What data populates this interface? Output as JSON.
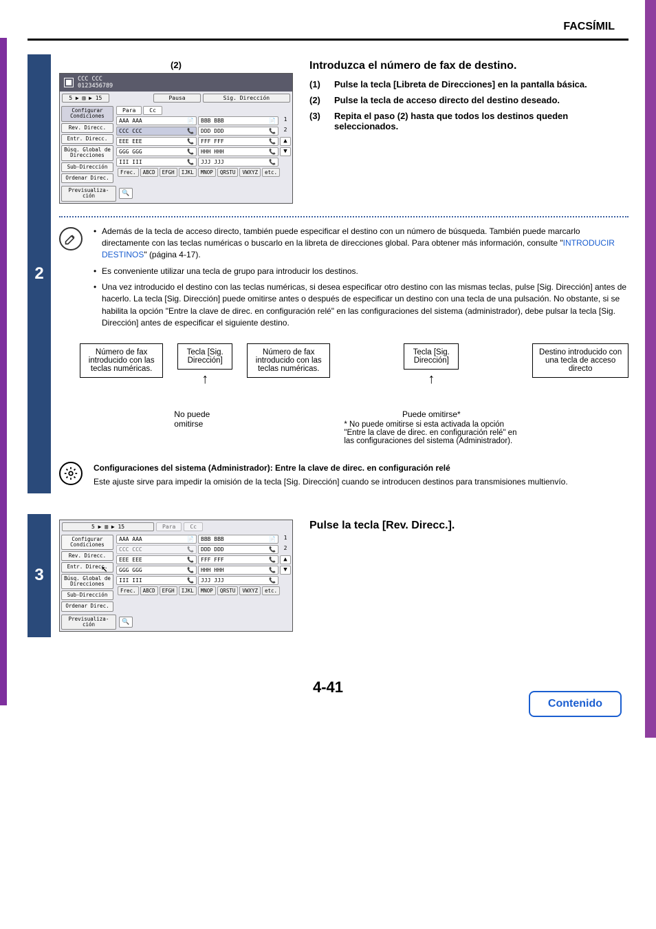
{
  "header": {
    "title": "FACSÍMIL"
  },
  "page_number": "4-41",
  "contenido": "Contenido",
  "step2": {
    "num": "2",
    "label_above": "(2)",
    "heading": "Introduzca el número de fax de destino.",
    "substeps": [
      {
        "n": "(1)",
        "t": "Pulse la tecla [Libreta de Direcciones] en la pantalla básica."
      },
      {
        "n": "(2)",
        "t": "Pulse la tecla de acceso directo del destino deseado."
      },
      {
        "n": "(3)",
        "t": "Repita el paso (2) hasta que todos los destinos queden seleccionados."
      }
    ],
    "screenshot": {
      "dest_name": "CCC CCC",
      "dest_num": "0123456789",
      "btn_pausa": "Pausa",
      "btn_sig": "Sig. Dirección",
      "crumbs": "5 ▶ ▥ ▶ 15",
      "tab_para": "Para",
      "tab_cc": "Cc",
      "side": [
        "Configurar Condiciones",
        "Rev. Direcc.",
        "Entr. Direcc.",
        "Búsq. Global de Direcciones",
        "Sub-Dirección",
        "Ordenar Direc.",
        "Previsualiza-ción"
      ],
      "addr": [
        [
          "AAA AAA",
          "BBB BBB"
        ],
        [
          "CCC CCC",
          "DDD DDD"
        ],
        [
          "EEE EEE",
          "FFF FFF"
        ],
        [
          "GGG GGG",
          "HHH HHH"
        ],
        [
          "III III",
          "JJJ JJJ"
        ]
      ],
      "selected": "CCC CCC",
      "page_ind": [
        "1",
        "2"
      ],
      "bottom": [
        "Frec.",
        "ABCD",
        "EFGH",
        "IJKL",
        "MNOP",
        "QRSTU",
        "VWXYZ",
        "etc."
      ]
    },
    "notes": [
      "Además de la tecla de acceso directo, también puede especificar el destino con un número de búsqueda. También puede marcarlo directamente con las teclas numéricas o buscarlo en la libreta de direcciones global. Para obtener más información, consulte \"INTRODUCIR DESTINOS\" (página 4-17).",
      "Es conveniente utilizar una tecla de grupo para introducir los destinos.",
      "Una vez introducido el destino con las teclas numéricas, si desea especificar otro destino con las mismas teclas, pulse [Sig. Dirección] antes de hacerlo. La tecla [Sig. Dirección] puede omitirse antes o después de especificar un destino con una tecla de una pulsación. No obstante, si se habilita la opción \"Entre la clave de direc. en configuración relé\" en las configuraciones del sistema (administrador), debe pulsar la tecla [Sig. Dirección] antes de especificar el siguiente destino."
    ],
    "note_link": "INTRODUCIR DESTINOS",
    "diagram": {
      "box1": "Número de fax introducido con las teclas numéricas.",
      "box2": "Tecla [Sig. Dirección]",
      "box3": "Número de fax introducido con las teclas numéricas.",
      "box4": "Tecla [Sig. Dirección]",
      "box5": "Destino introducido con una tecla de acceso directo",
      "cannot_omit": "No puede omitirse",
      "can_omit": "Puede omitirse*",
      "footnote": "* No puede omitirse si esta activada la opción \"Entre la clave de direc. en configuración relé\" en las configuraciones del sistema (Administrador)."
    },
    "admin": {
      "title": "Configuraciones del sistema (Administrador): Entre la clave de direc. en configuración relé",
      "body": "Este ajuste sirve para impedir la omisión de la tecla [Sig. Dirección] cuando se introducen destinos para transmisiones multienvío."
    }
  },
  "step3": {
    "num": "3",
    "heading": "Pulse la tecla [Rev. Direcc.].",
    "screenshot": {
      "crumbs": "5 ▶ ▥ ▶ 15",
      "tab_para": "Para",
      "tab_cc": "Cc",
      "side": [
        "Configurar Condiciones",
        "Rev. Direcc.",
        "Entr. Direcc.",
        "Búsq. Global de Direcciones",
        "Sub-Dirección",
        "Ordenar Direc.",
        "Previsualiza-ción"
      ],
      "addr": [
        [
          "AAA AAA",
          "BBB BBB"
        ],
        [
          "CCC CCC",
          "DDD DDD"
        ],
        [
          "EEE EEE",
          "FFF FFF"
        ],
        [
          "GGG GGG",
          "HHH HHH"
        ],
        [
          "III III",
          "JJJ JJJ"
        ]
      ],
      "page_ind": [
        "1",
        "2"
      ],
      "bottom": [
        "Frec.",
        "ABCD",
        "EFGH",
        "IJKL",
        "MNOP",
        "QRSTU",
        "VWXYZ",
        "etc."
      ]
    }
  }
}
